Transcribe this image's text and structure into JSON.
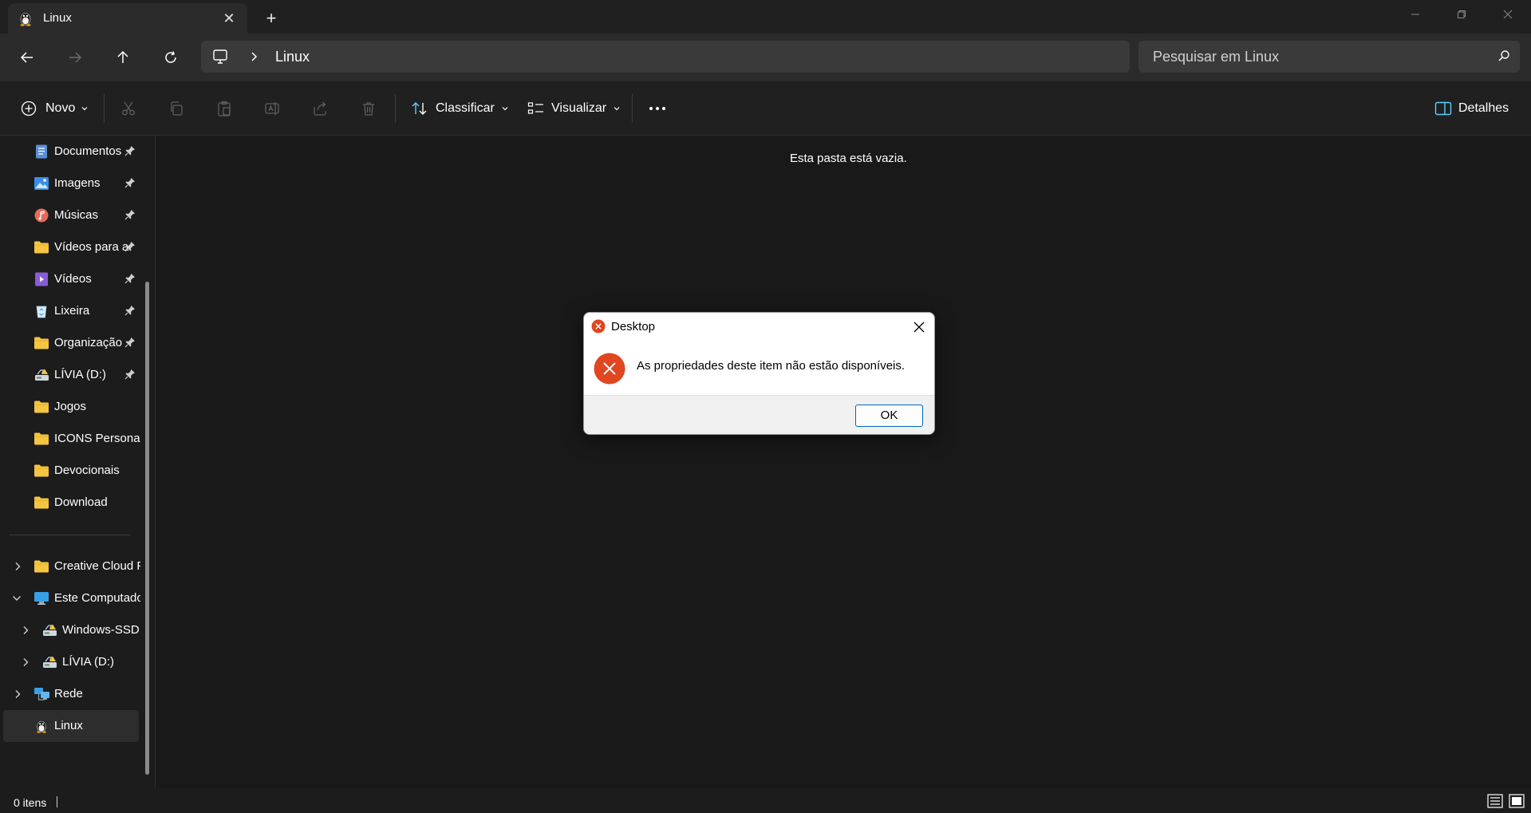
{
  "tab": {
    "title": "Linux",
    "icon": "linux-penguin-icon"
  },
  "navbar": {
    "address": "Linux",
    "search_placeholder": "Pesquisar em Linux"
  },
  "commandbar": {
    "new_label": "Novo",
    "sort_label": "Classificar",
    "view_label": "Visualizar",
    "details_label": "Detalhes"
  },
  "sidebar": {
    "pinned": [
      {
        "label": "Documentos",
        "icon": "documents-icon",
        "pinned": true
      },
      {
        "label": "Imagens",
        "icon": "pictures-icon",
        "pinned": true
      },
      {
        "label": "Músicas",
        "icon": "music-icon",
        "pinned": true
      },
      {
        "label": "Vídeos para a",
        "icon": "folder-icon",
        "pinned": true
      },
      {
        "label": "Vídeos",
        "icon": "videos-icon",
        "pinned": true
      },
      {
        "label": "Lixeira",
        "icon": "recycle-bin-icon",
        "pinned": true
      },
      {
        "label": "Organização",
        "icon": "folder-icon",
        "pinned": true
      },
      {
        "label": "LÍVIA (D:)",
        "icon": "drive-icon",
        "pinned": true
      },
      {
        "label": "Jogos",
        "icon": "folder-icon",
        "pinned": false
      },
      {
        "label": "ICONS Personas",
        "icon": "folder-icon",
        "pinned": false
      },
      {
        "label": "Devocionais",
        "icon": "folder-icon",
        "pinned": false
      },
      {
        "label": "Download",
        "icon": "folder-icon",
        "pinned": false
      }
    ],
    "tree": [
      {
        "label": "Creative Cloud F",
        "icon": "folder-icon",
        "chevron": "right"
      },
      {
        "label": "Este Computador",
        "icon": "computer-icon",
        "chevron": "down"
      },
      {
        "label": "Windows-SSD",
        "icon": "drive-icon",
        "chevron": "right"
      },
      {
        "label": "LÍVIA (D:)",
        "icon": "drive-icon",
        "chevron": "right"
      },
      {
        "label": "Rede",
        "icon": "network-icon",
        "chevron": "right"
      },
      {
        "label": "Linux",
        "icon": "linux-penguin-icon",
        "chevron": "none"
      }
    ]
  },
  "main": {
    "empty_message": "Esta pasta está vazia."
  },
  "status": {
    "item_count": "0 itens"
  },
  "dialog": {
    "title": "Desktop",
    "message": "As propriedades deste item não estão disponíveis.",
    "ok_label": "OK"
  },
  "colors": {
    "background": "#191919",
    "sidebar": "#1c1c1c",
    "navbar": "#2b2b2b",
    "folder": "#f5c542",
    "error": "#e0461f",
    "accent": "#0067c0"
  }
}
